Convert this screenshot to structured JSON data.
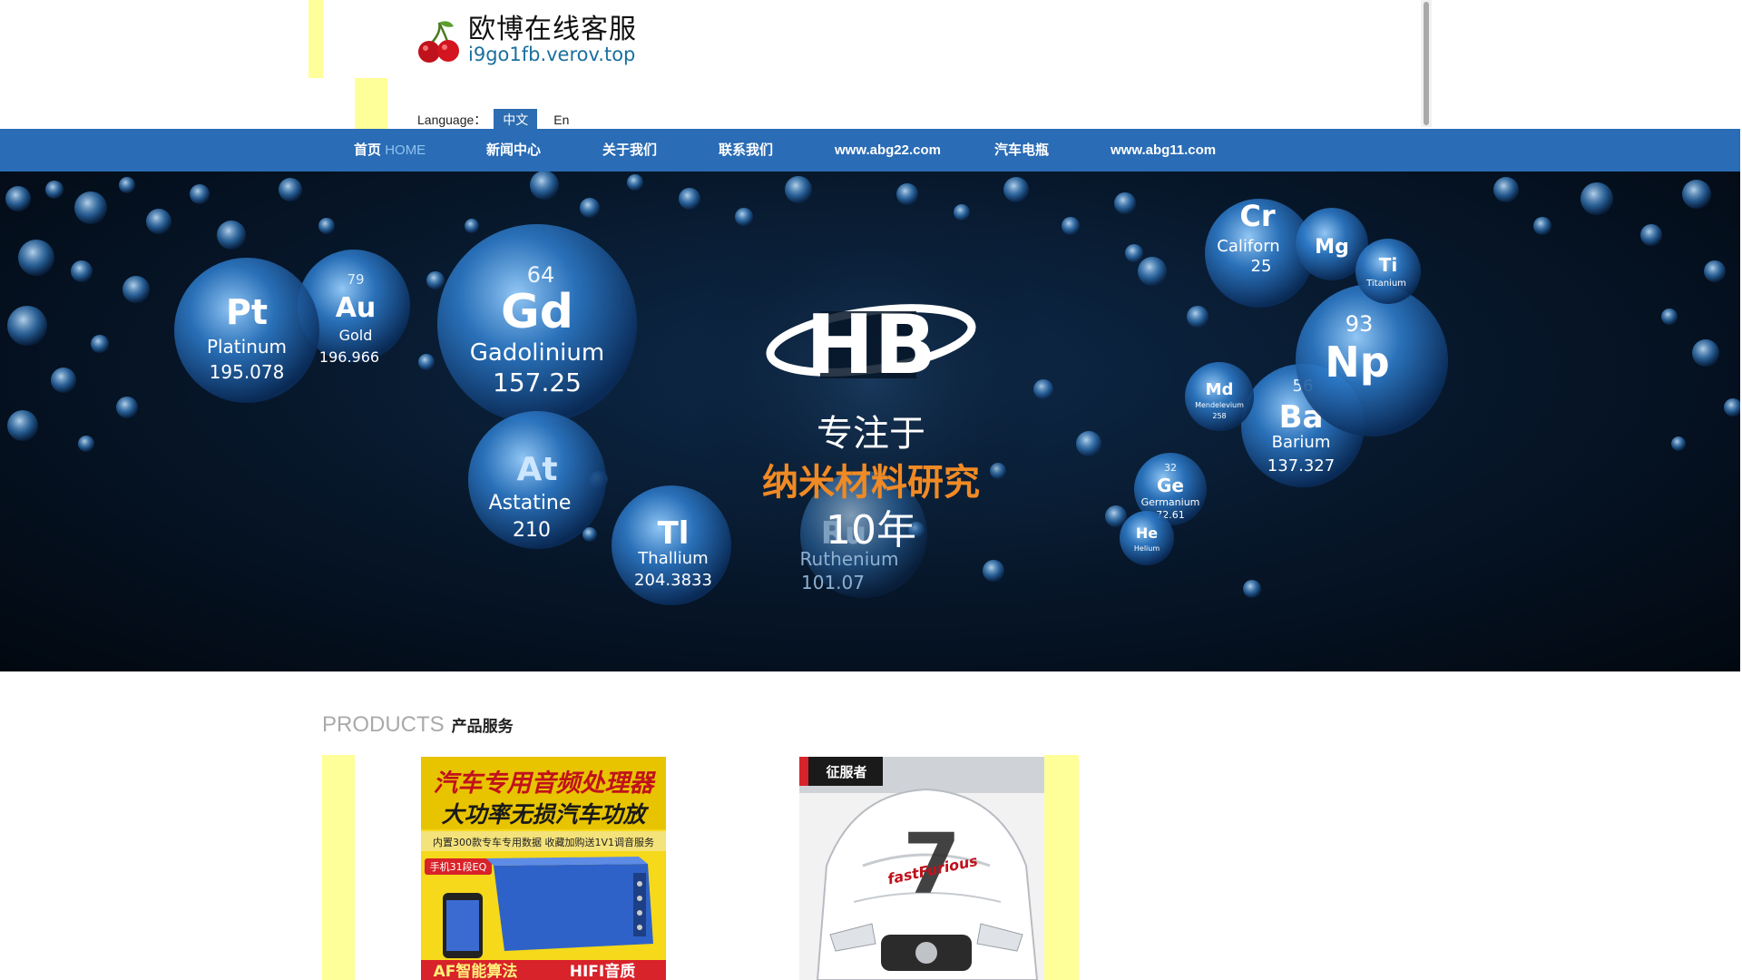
{
  "header": {
    "site_title": "欧博在线客服",
    "site_domain": "i9go1fb.verov.top",
    "logo_icon": "cherry-icon"
  },
  "language": {
    "label": "Language：",
    "options": [
      "中文",
      "En"
    ],
    "selected": "中文"
  },
  "nav": {
    "items": [
      {
        "label": "首页",
        "sub": "HOME"
      },
      {
        "label": "新闻中心"
      },
      {
        "label": "关于我们"
      },
      {
        "label": "联系我们"
      },
      {
        "label": "www.abg22.com"
      },
      {
        "label": "汽车电瓶"
      },
      {
        "label": "www.abg11.com"
      }
    ]
  },
  "banner": {
    "logo_text": "HB",
    "line1": "专注于",
    "line2": "纳米材料研究",
    "line3": "10年",
    "elements": [
      {
        "num": "64",
        "sym": "Gd",
        "name": "Gadolinium",
        "mass": "157.25"
      },
      {
        "num": "79",
        "sym": "Au",
        "name": "Gold",
        "mass": "196.966"
      },
      {
        "sym": "Pt",
        "name": "Platinum",
        "mass": "195.078"
      },
      {
        "sym": "At",
        "name": "Astatine",
        "mass": "210"
      },
      {
        "sym": "Tl",
        "name": "Thallium",
        "mass": "204.3833"
      },
      {
        "num": "56",
        "sym": "Ba",
        "name": "Barium",
        "mass": "137.327"
      },
      {
        "num": "93",
        "sym": "Np"
      },
      {
        "num": "32",
        "sym": "Ge",
        "name": "Germanium",
        "mass": "72.61"
      },
      {
        "sym": "He",
        "name": "Helium"
      },
      {
        "sym": "Ru",
        "name": "Ruthenium",
        "mass": "101.07"
      },
      {
        "sym": "Cr",
        "name": "Californ",
        "mass": "25"
      },
      {
        "sym": "Mg"
      },
      {
        "sym": "Ti",
        "name": "Titanium"
      },
      {
        "sym": "Md",
        "name": "Mendelevium",
        "mass": "258"
      }
    ]
  },
  "products": {
    "heading_en": "PRODUCTS",
    "heading_cn": "产品服务",
    "items": [
      {
        "title1": "汽车专用音频处理器",
        "title2": "大功率无损汽车功放",
        "subline": "内置300款专车专用数据 收藏加购送1V1调音服务",
        "tag": "手机31段EQ",
        "bottom_left": "AF智能算法",
        "bottom_right": "HIFI音质"
      },
      {
        "badge": "征服者",
        "decal_text": "fastFurious",
        "decal_number": "7"
      }
    ]
  },
  "colors": {
    "nav_bg": "#2a6cb5",
    "yellow_strip": "#ffff99",
    "domain_text": "#1b6f9e",
    "highlight_orange": "#f08a24"
  }
}
